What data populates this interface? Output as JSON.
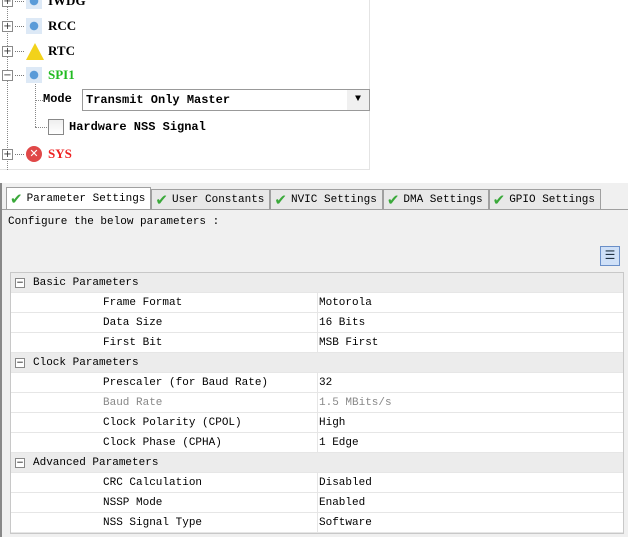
{
  "tree": {
    "nodes": [
      {
        "label": "IWDG",
        "color": "#000000",
        "icon": "cube-icon",
        "expander": "+"
      },
      {
        "label": "RCC",
        "color": "#000000",
        "icon": "cube-icon",
        "expander": "+"
      },
      {
        "label": "RTC",
        "color": "#000000",
        "icon": "warning-icon",
        "expander": "+"
      },
      {
        "label": "SPI1",
        "color": "#22bb22",
        "icon": "cube-icon",
        "expander": "−"
      },
      {
        "label": "SYS",
        "color": "#ee2222",
        "icon": "error-icon",
        "expander": "+"
      }
    ],
    "mode_label": "Mode",
    "mode_value": "Transmit Only Master",
    "hw_nss_label": "Hardware NSS Signal",
    "hw_nss_checked": false
  },
  "tabs": [
    {
      "label": "Parameter Settings",
      "active": true
    },
    {
      "label": "User Constants"
    },
    {
      "label": "NVIC Settings"
    },
    {
      "label": "DMA Settings"
    },
    {
      "label": "GPIO Settings"
    }
  ],
  "configure_text": "Configure the below parameters :",
  "groups": [
    {
      "title": "Basic Parameters",
      "params": [
        {
          "name": "Frame Format",
          "value": "Motorola"
        },
        {
          "name": "Data Size",
          "value": "16 Bits"
        },
        {
          "name": "First Bit",
          "value": "MSB First"
        }
      ]
    },
    {
      "title": "Clock Parameters",
      "params": [
        {
          "name": "Prescaler (for Baud Rate)",
          "value": "32"
        },
        {
          "name": "Baud Rate",
          "value": "1.5 MBits/s",
          "disabled": true
        },
        {
          "name": "Clock Polarity (CPOL)",
          "value": "High"
        },
        {
          "name": "Clock Phase (CPHA)",
          "value": "1 Edge"
        }
      ]
    },
    {
      "title": "Advanced Parameters",
      "params": [
        {
          "name": "CRC Calculation",
          "value": "Disabled"
        },
        {
          "name": "NSSP Mode",
          "value": "Enabled"
        },
        {
          "name": "NSS Signal Type",
          "value": "Software"
        }
      ]
    }
  ]
}
